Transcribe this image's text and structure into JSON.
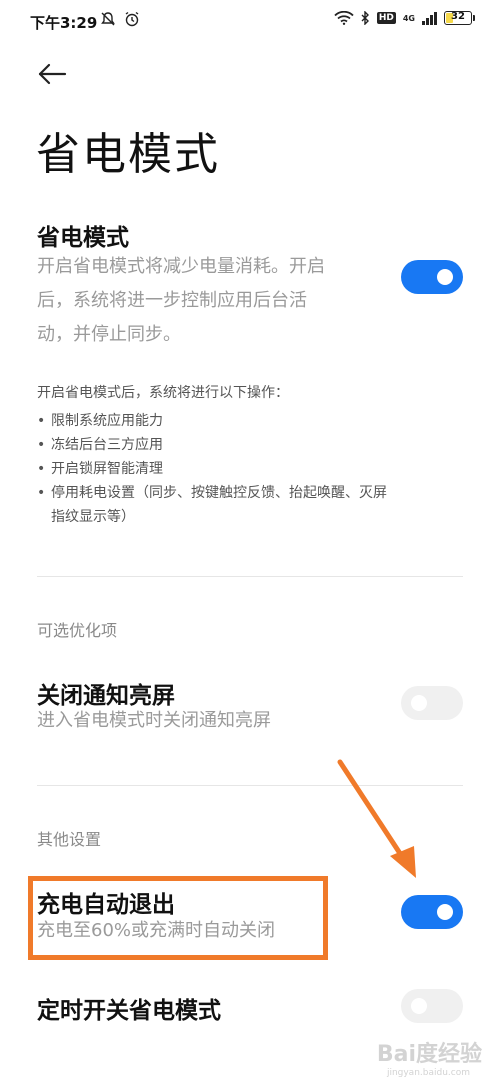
{
  "status_bar": {
    "time": "下午3:29",
    "network": "4G",
    "hd": "HD",
    "battery_level": "32",
    "battery_fraction": 0.32,
    "icons": [
      "mute-icon",
      "alarm-icon",
      "wifi-icon",
      "bluetooth-icon",
      "signal-icon",
      "battery-icon"
    ]
  },
  "header": {
    "back_icon": "arrow-left-icon",
    "title": "省电模式"
  },
  "power_saving": {
    "title": "省电模式",
    "desc_lines": [
      "开启省电模式将减少电量消耗。开启",
      "后，系统将进一步控制应用后台活",
      "动，并停止同步。"
    ],
    "toggle_on": true
  },
  "info": {
    "intro": "开启省电模式后，系统将进行以下操作：",
    "items": [
      "限制系统应用能力",
      "冻结后台三方应用",
      "开启锁屏智能清理",
      "停用耗电设置（同步、按键触控反馈、抬起唤醒、灭屏",
      "指纹显示等）"
    ]
  },
  "sections": {
    "optional": "可选优化项",
    "other": "其他设置"
  },
  "notify_screen": {
    "title": "关闭通知亮屏",
    "desc": "进入省电模式时关闭通知亮屏",
    "toggle_on": false
  },
  "charge_exit": {
    "title": "充电自动退出",
    "desc": "充电至60%或充满时自动关闭",
    "toggle_on": true
  },
  "scheduled": {
    "title": "定时开关省电模式",
    "toggle_on": false
  },
  "colors": {
    "accent": "#1878f3",
    "annotation": "#f07a2a"
  },
  "watermark": {
    "text": "Bai度经验",
    "sub": "jingyan.baidu.com"
  }
}
